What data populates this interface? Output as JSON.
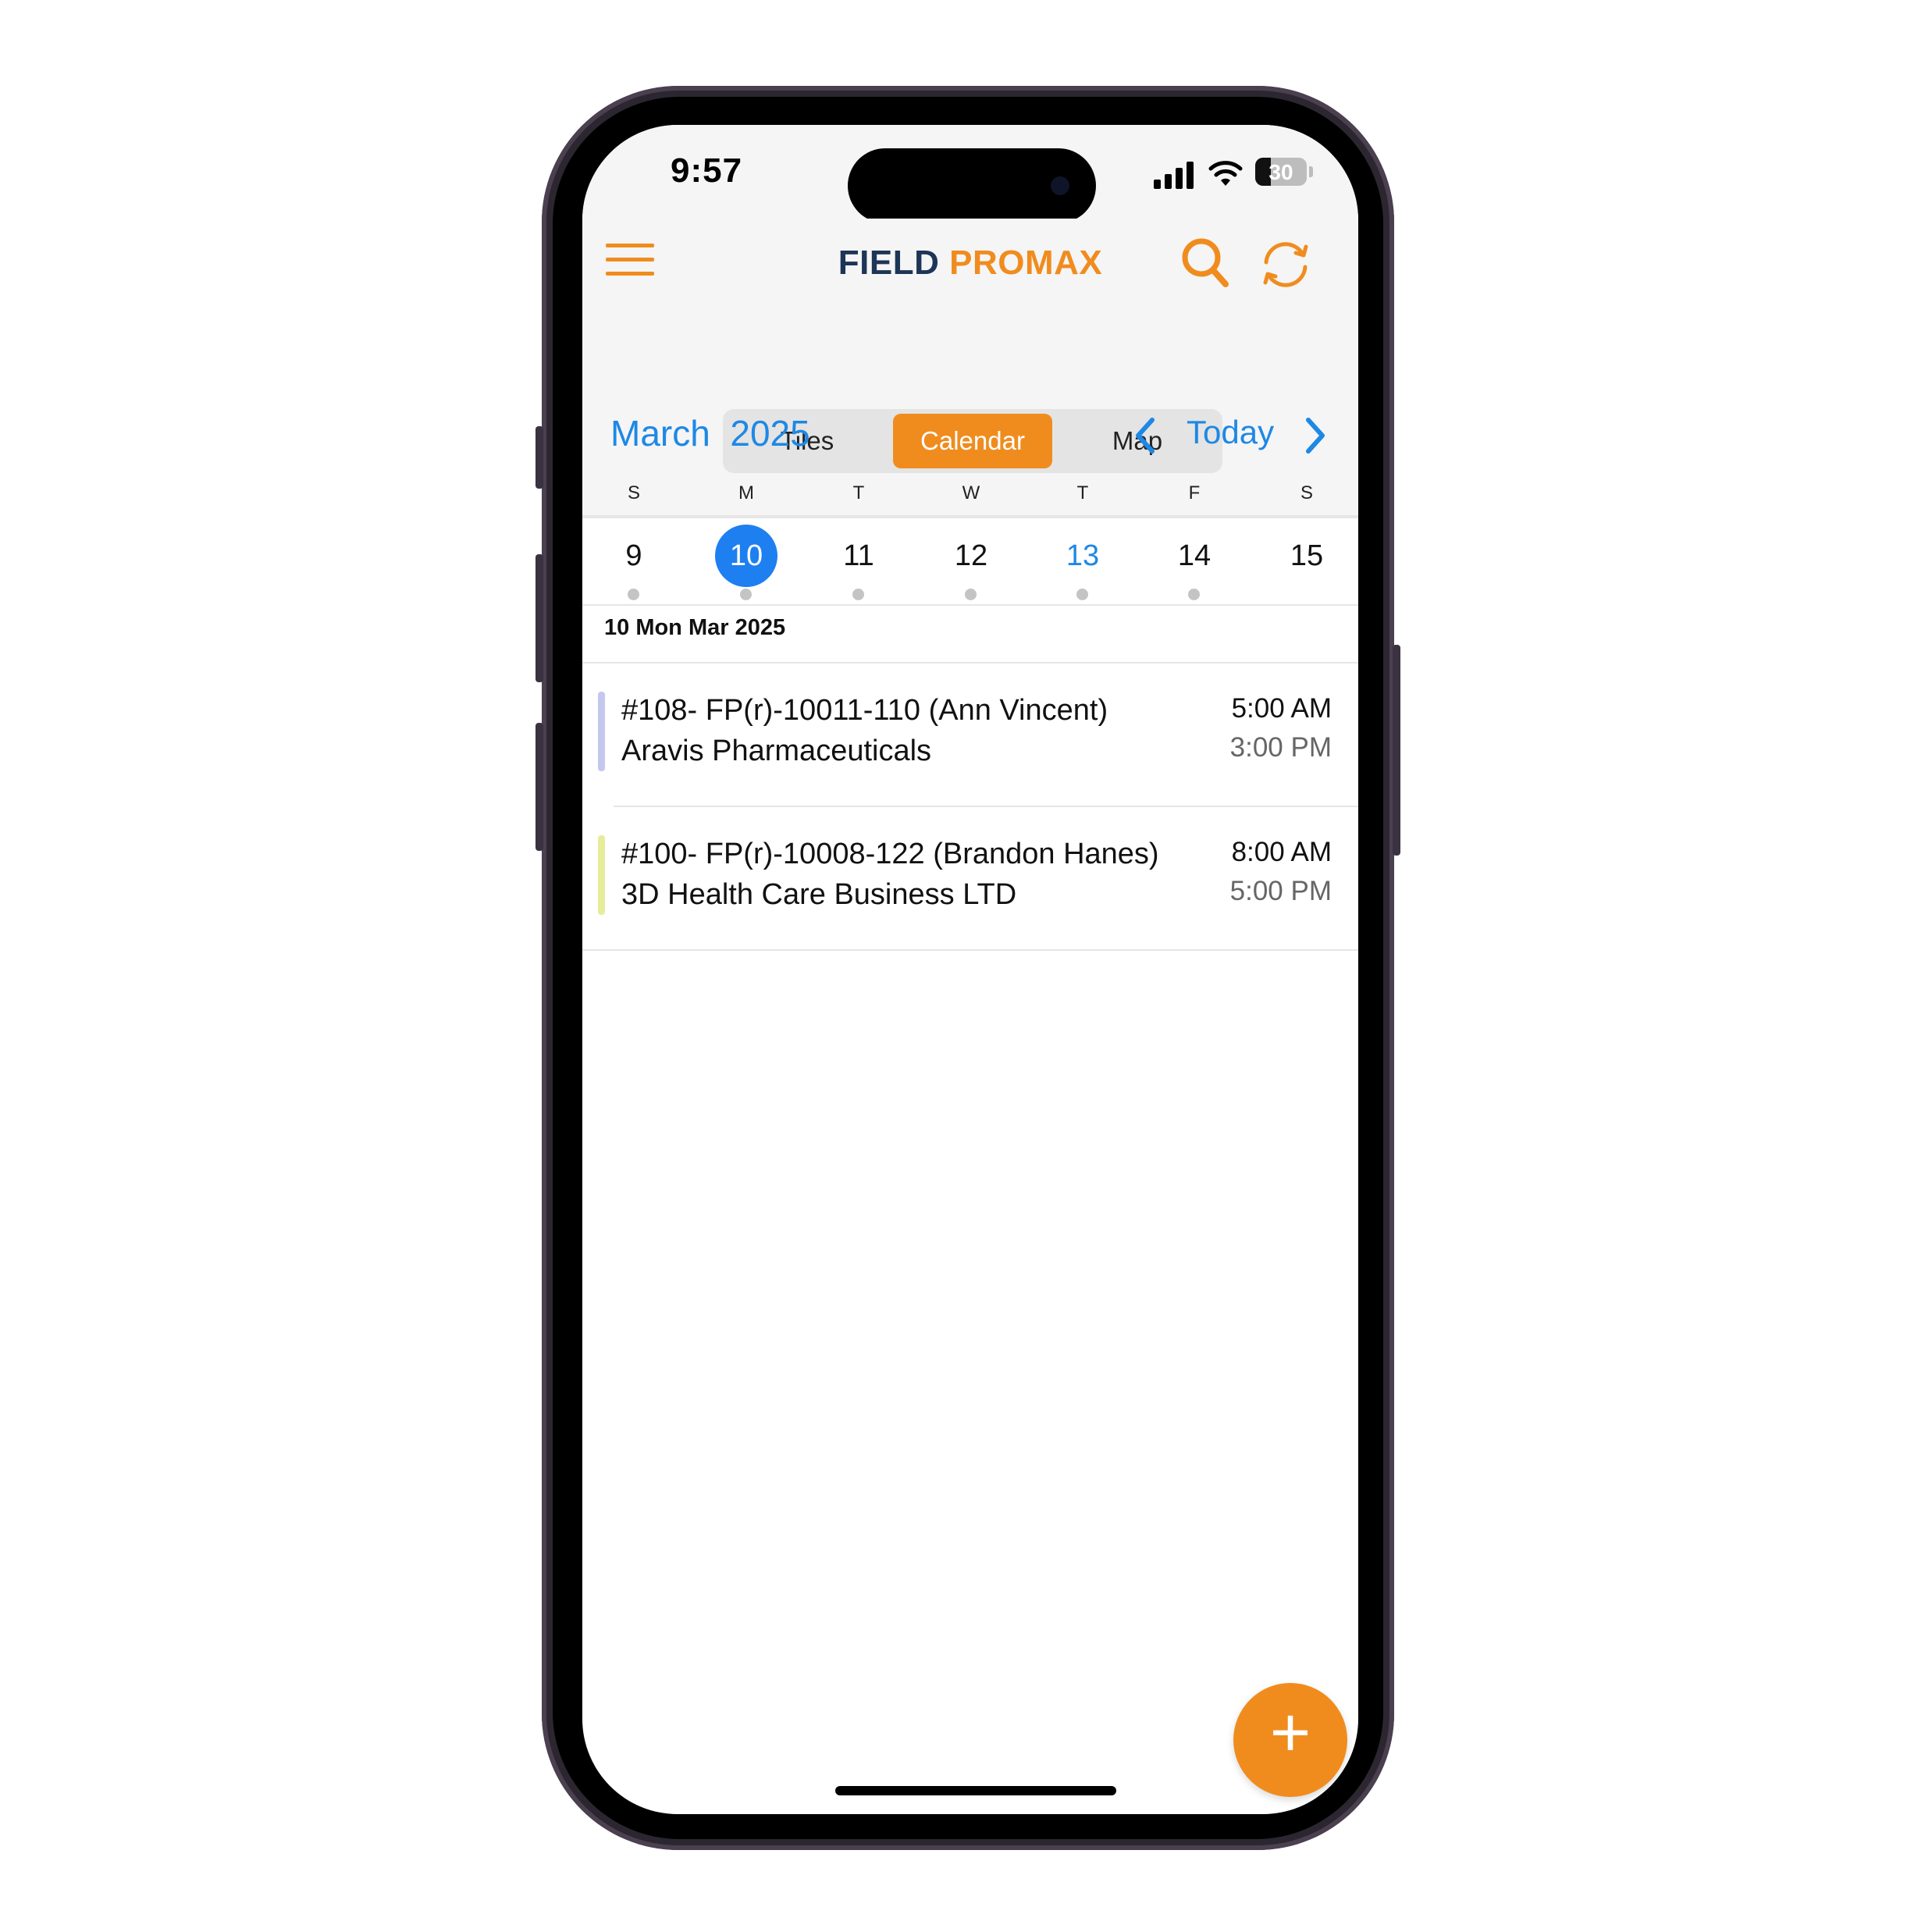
{
  "status_bar": {
    "time": "9:57",
    "battery": "30"
  },
  "header": {
    "logo_part1": "FIELD",
    "logo_part2": "PROMAX",
    "segments": {
      "tiles": "Tiles",
      "calendar": "Calendar",
      "map": "Map"
    },
    "active_segment": "Calendar"
  },
  "calendar": {
    "month_label": "March  2025",
    "today_label": "Today",
    "weekdays": [
      "S",
      "M",
      "T",
      "W",
      "T",
      "F",
      "S"
    ],
    "days": [
      "9",
      "10",
      "11",
      "12",
      "13",
      "14",
      "15"
    ],
    "selected_day": "10",
    "highlighted_day": "13",
    "selected_date_label": "10 Mon Mar 2025"
  },
  "events": [
    {
      "title": "#108- FP(r)-10011-110 (Ann Vincent) Aravis Pharmaceuticals",
      "start": "5:00 AM",
      "end": "3:00 PM",
      "color": "#c5c8ee"
    },
    {
      "title": "#100- FP(r)-10008-122 (Brandon Hanes) 3D Health Care Business LTD",
      "start": "8:00 AM",
      "end": "5:00 PM",
      "color": "#e6ec9a"
    }
  ],
  "colors": {
    "accent": "#f08c1e",
    "link": "#1e88e5",
    "selected_day": "#1e7ff0",
    "logo_dark": "#1d3557"
  },
  "icons": [
    "menu-icon",
    "search-icon",
    "sync-icon",
    "chevron-left-icon",
    "chevron-right-icon",
    "plus-icon"
  ]
}
